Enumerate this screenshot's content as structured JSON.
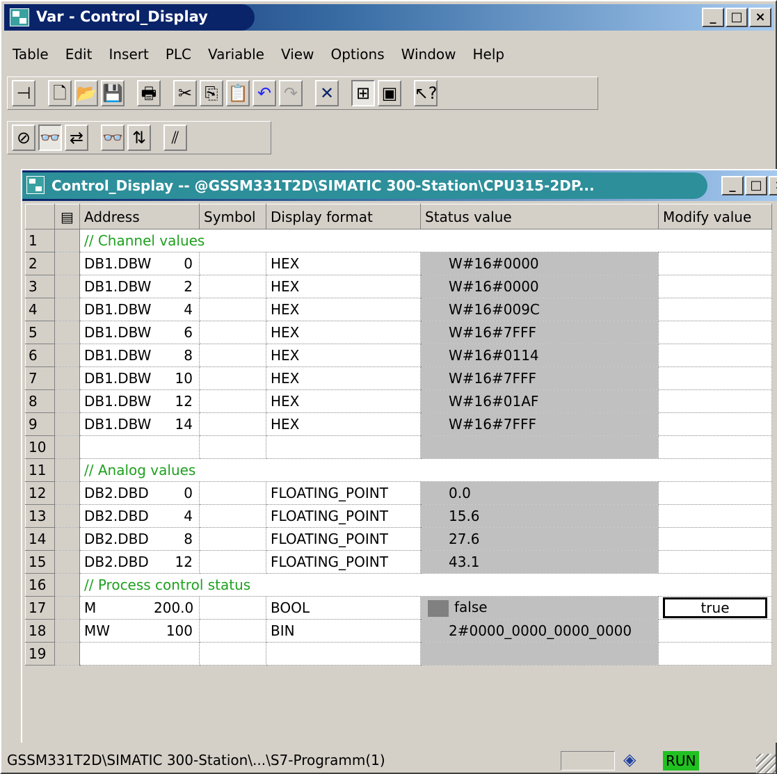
{
  "window": {
    "title": "Var - Control_Display",
    "buttons": [
      "_",
      "□",
      "×"
    ]
  },
  "menu": [
    "Table",
    "Edit",
    "Insert",
    "PLC",
    "Variable",
    "View",
    "Options",
    "Window",
    "Help"
  ],
  "child_window": {
    "title": "Control_Display -- @GSSM331T2D\\SIMATIC 300-Station\\CPU315-2DP..."
  },
  "table": {
    "headers": {
      "address": "Address",
      "symbol": "Symbol",
      "display_format": "Display format",
      "status_value": "Status value",
      "modify_value": "Modify value"
    },
    "rows": [
      {
        "n": "1",
        "comment": "// Channel values"
      },
      {
        "n": "2",
        "address": "DB1.DBW",
        "offset": "0",
        "format": "HEX",
        "status": "W#16#0000"
      },
      {
        "n": "3",
        "address": "DB1.DBW",
        "offset": "2",
        "format": "HEX",
        "status": "W#16#0000"
      },
      {
        "n": "4",
        "address": "DB1.DBW",
        "offset": "4",
        "format": "HEX",
        "status": "W#16#009C"
      },
      {
        "n": "5",
        "address": "DB1.DBW",
        "offset": "6",
        "format": "HEX",
        "status": "W#16#7FFF"
      },
      {
        "n": "6",
        "address": "DB1.DBW",
        "offset": "8",
        "format": "HEX",
        "status": "W#16#0114"
      },
      {
        "n": "7",
        "address": "DB1.DBW",
        "offset": "10",
        "format": "HEX",
        "status": "W#16#7FFF"
      },
      {
        "n": "8",
        "address": "DB1.DBW",
        "offset": "12",
        "format": "HEX",
        "status": "W#16#01AF"
      },
      {
        "n": "9",
        "address": "DB1.DBW",
        "offset": "14",
        "format": "HEX",
        "status": "W#16#7FFF"
      },
      {
        "n": "10"
      },
      {
        "n": "11",
        "comment": "// Analog values"
      },
      {
        "n": "12",
        "address": "DB2.DBD",
        "offset": "0",
        "format": "FLOATING_POINT",
        "status": "0.0"
      },
      {
        "n": "13",
        "address": "DB2.DBD",
        "offset": "4",
        "format": "FLOATING_POINT",
        "status": "15.6"
      },
      {
        "n": "14",
        "address": "DB2.DBD",
        "offset": "8",
        "format": "FLOATING_POINT",
        "status": "27.6"
      },
      {
        "n": "15",
        "address": "DB2.DBD",
        "offset": "12",
        "format": "FLOATING_POINT",
        "status": "43.1"
      },
      {
        "n": "16",
        "comment": "// Process control status"
      },
      {
        "n": "17",
        "address": "M",
        "offset": "200.0",
        "format": "BOOL",
        "status": "false",
        "modify": "true"
      },
      {
        "n": "18",
        "address": "MW",
        "offset": "100",
        "format": "BIN",
        "status": "2#0000_0000_0000_0000"
      },
      {
        "n": "19"
      }
    ]
  },
  "statusbar": {
    "path": "GSSM331T2D\\SIMATIC 300-Station\\...\\S7-Programm(1)",
    "mode": "RUN",
    "colors": {
      "run": "#21c021"
    }
  },
  "colors": {
    "comment": "#1ea01e",
    "status_cell": "#c0c0c0",
    "title_dark": "#0a246a",
    "child_title": "#2d8f9a"
  }
}
